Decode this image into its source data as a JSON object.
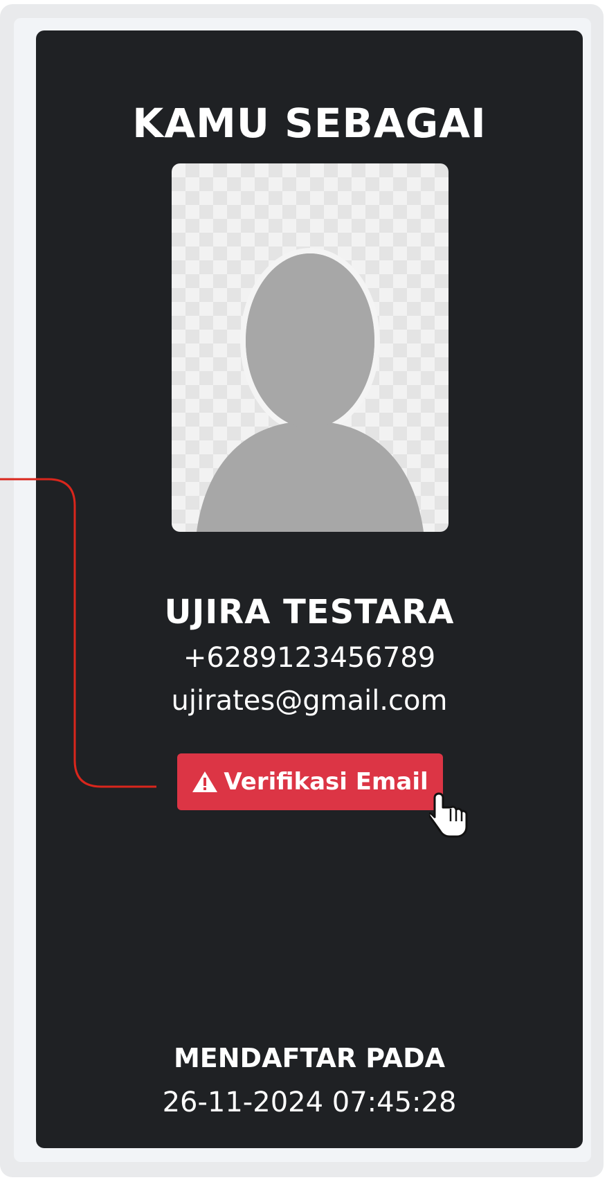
{
  "card": {
    "title": "KAMU SEBAGAI",
    "photo_icon": "user-silhouette-icon",
    "name": "UJIRA TESTARA",
    "phone": "+6289123456789",
    "email": "ujirates@gmail.com",
    "verify_button": {
      "icon": "warning-icon",
      "label": "Verifikasi Email"
    },
    "registered_label": "MENDAFTAR PADA",
    "registered_value": "26-11-2024 07:45:28"
  },
  "colors": {
    "card_background": "#1f2124",
    "button_danger": "#dc3545",
    "annotation_line": "#d9261c"
  }
}
